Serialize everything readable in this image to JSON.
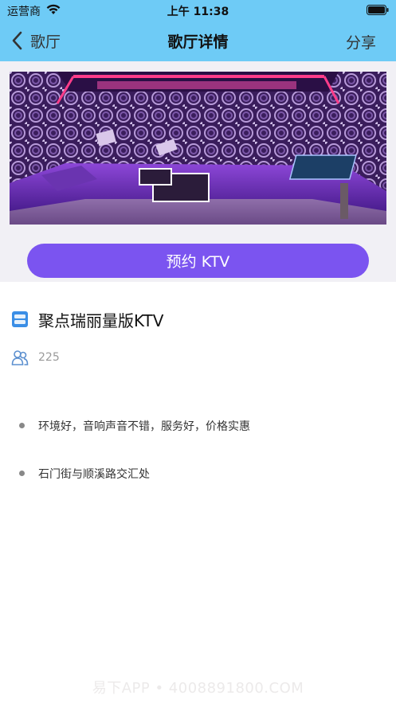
{
  "status_bar": {
    "carrier": "运营商",
    "time": "上午 11:38"
  },
  "nav": {
    "back_label": "歌厅",
    "title": "歌厅详情",
    "share_label": "分享"
  },
  "hero": {
    "reserve_label": "预约 KTV"
  },
  "venue": {
    "name": "聚点瑞丽量版KTV",
    "capacity": "225",
    "features": "环境好，音响声音不错，服务好，价格实惠",
    "address": "石门街与顺溪路交汇处"
  },
  "watermark": "易下APP • 4008891800.COM",
  "colors": {
    "nav_bg": "#6ecbf6",
    "button_bg": "#7b54f0",
    "hero_bg": "#f1f0f5"
  },
  "icons": [
    "wifi-icon",
    "battery-icon",
    "chevron-left-icon",
    "venue-icon",
    "people-icon"
  ]
}
